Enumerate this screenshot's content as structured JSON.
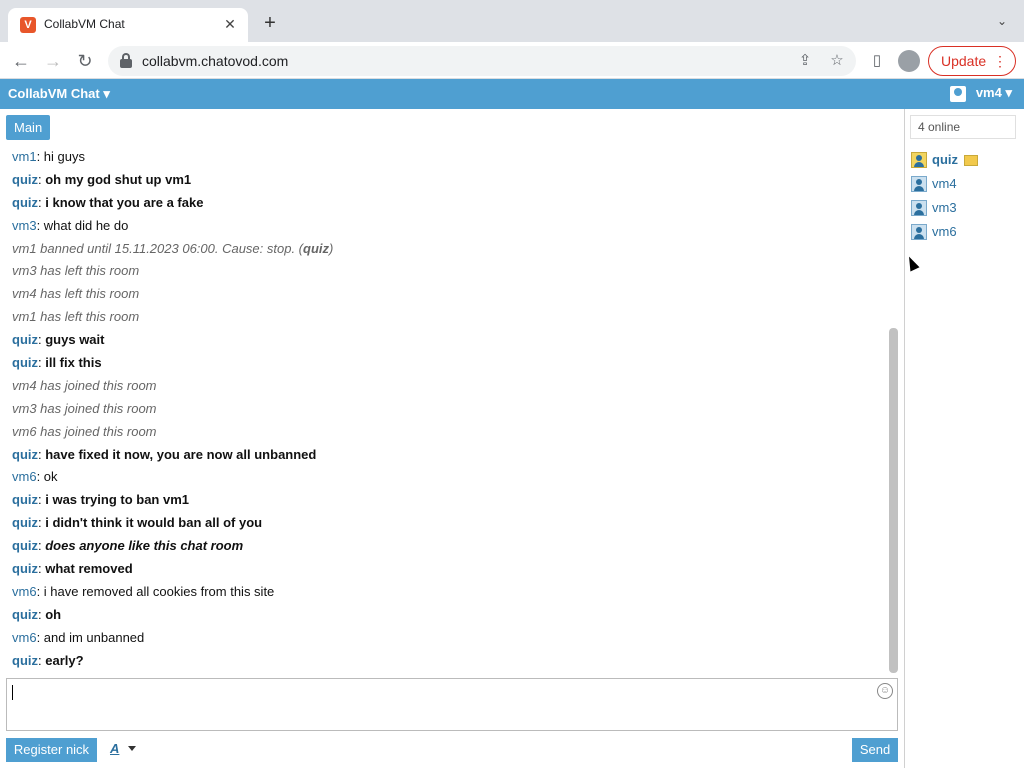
{
  "browser": {
    "tab_title": "CollabVM Chat",
    "favicon_letter": "V",
    "url": "collabvm.chatovod.com",
    "update_label": "Update"
  },
  "header": {
    "title": "CollabVM Chat",
    "current_user": "vm4"
  },
  "room_tab": "Main",
  "online_count": "4 online",
  "users": [
    {
      "name": "quiz",
      "admin": true
    },
    {
      "name": "vm4",
      "admin": false
    },
    {
      "name": "vm3",
      "admin": false
    },
    {
      "name": "vm6",
      "admin": false
    }
  ],
  "messages": [
    {
      "nick": "vm1",
      "text": "hi guys",
      "kind": "normal"
    },
    {
      "nick": "quiz",
      "text": "oh my god shut up vm1",
      "kind": "bold"
    },
    {
      "nick": "quiz",
      "text": "i know that you are a fake",
      "kind": "bold"
    },
    {
      "nick": "vm3",
      "text": "what did he do",
      "kind": "normal"
    },
    {
      "text": "vm1 banned until 15.11.2023 06:00. Cause: stop. (",
      "by": "quiz",
      "tail": ")",
      "kind": "ban"
    },
    {
      "text": "vm3 has left this room",
      "kind": "system"
    },
    {
      "text": "vm4 has left this room",
      "kind": "system"
    },
    {
      "text": "vm1 has left this room",
      "kind": "system"
    },
    {
      "nick": "quiz",
      "text": "guys wait",
      "kind": "bold"
    },
    {
      "nick": "quiz",
      "text": "ill fix this",
      "kind": "bold"
    },
    {
      "text": "vm4 has joined this room",
      "kind": "system"
    },
    {
      "text": "vm3 has joined this room",
      "kind": "system"
    },
    {
      "text": "vm6 has joined this room",
      "kind": "system"
    },
    {
      "nick": "quiz",
      "text": "have fixed it now, you are now all unbanned",
      "kind": "bold"
    },
    {
      "nick": "vm6",
      "text": "ok",
      "kind": "normal"
    },
    {
      "nick": "quiz",
      "text": "i was trying to ban vm1",
      "kind": "bold"
    },
    {
      "nick": "quiz",
      "text": "i didn't think it would ban all of you",
      "kind": "bold"
    },
    {
      "nick": "quiz",
      "text": "does anyone like this chat room",
      "kind": "bolditalic"
    },
    {
      "nick": "quiz",
      "text": "what removed",
      "kind": "bold"
    },
    {
      "nick": "vm6",
      "text": "i have removed all cookies from this site",
      "kind": "normal"
    },
    {
      "nick": "quiz",
      "text": "oh",
      "kind": "bold"
    },
    {
      "nick": "vm6",
      "text": "and im unbanned",
      "kind": "normal"
    },
    {
      "nick": "quiz",
      "text": "early?",
      "kind": "bold"
    }
  ],
  "input": {
    "value": ""
  },
  "footer": {
    "register_label": "Register nick",
    "format_label": "A",
    "send_label": "Send"
  }
}
